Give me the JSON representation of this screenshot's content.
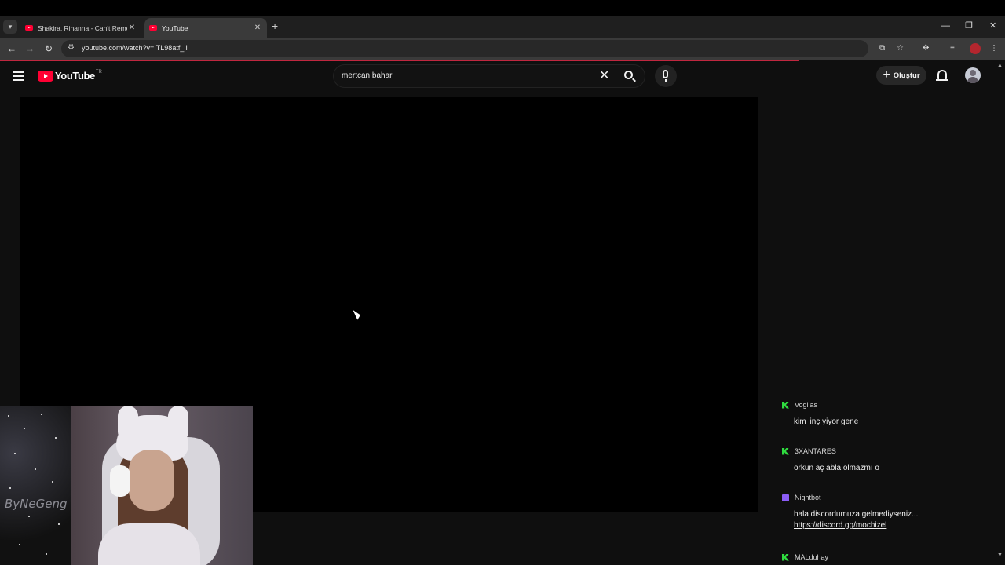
{
  "browser": {
    "tabs": [
      {
        "title": "Shakira, Rihanna - Can't Remem",
        "active": false
      },
      {
        "title": "YouTube",
        "active": true
      }
    ],
    "url": "youtube.com/watch?v=ITL98atf_lI"
  },
  "youtube": {
    "logo_text": "YouTube",
    "country_code": "TR",
    "search_query": "mertcan bahar",
    "create_label": "Oluştur"
  },
  "webcam": {
    "watermark": "ByNeGeng"
  },
  "chat": {
    "messages": [
      {
        "user": "Voglias",
        "platform": "kick",
        "text": "kim linç yiyor gene"
      },
      {
        "user": "3XANTARES",
        "platform": "kick",
        "text": "orkun aç abla olmazmı o"
      },
      {
        "user": "Nightbot",
        "platform": "twitch",
        "text": "hala discordumuza gelmediyseniz...",
        "link": "https://discord.gg/mochizel"
      },
      {
        "user": "MALduhay",
        "platform": "kick",
        "text": ""
      }
    ]
  },
  "colors": {
    "youtube_red": "#ff0033",
    "kick_green": "#2fdc3f",
    "twitch_purple": "#8b5cf6",
    "background": "#0f0f0f"
  }
}
